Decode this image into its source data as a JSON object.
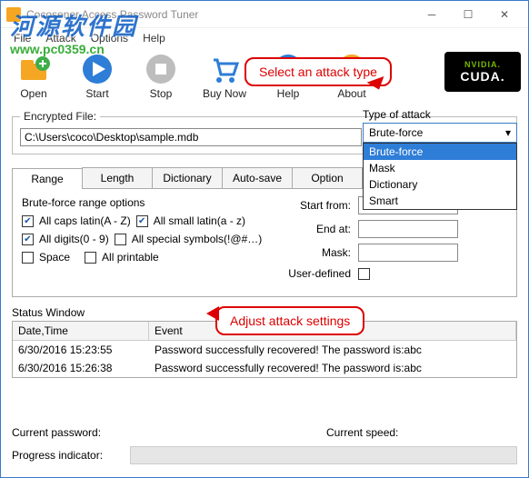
{
  "window": {
    "title": "Cocosenor Access Password Tuner"
  },
  "menu": {
    "file": "File",
    "attack": "Attack",
    "options": "Options",
    "help": "Help"
  },
  "watermark": {
    "cn": "河源软件园",
    "url": "www.pc0359.cn"
  },
  "toolbar": {
    "open": "Open",
    "start": "Start",
    "stop": "Stop",
    "buy": "Buy Now",
    "help": "Help",
    "about": "About"
  },
  "cuda": {
    "brand": "NVIDIA.",
    "name": "CUDA."
  },
  "callouts": {
    "attack": "Select an attack type",
    "adjust": "Adjust attack settings"
  },
  "file": {
    "label": "Encrypted File:",
    "path": "C:\\Users\\coco\\Desktop\\sample.mdb"
  },
  "attack": {
    "label": "Type of attack",
    "selected": "Brute-force",
    "options": [
      "Brute-force",
      "Mask",
      "Dictionary",
      "Smart"
    ]
  },
  "tabs": [
    "Range",
    "Length",
    "Dictionary",
    "Auto-save",
    "Option"
  ],
  "range": {
    "group": "Brute-force range options",
    "caps": "All caps latin(A - Z)",
    "small": "All small latin(a - z)",
    "digits": "All digits(0 - 9)",
    "symbols": "All special symbols(!@#…)",
    "space": "Space",
    "printable": "All printable",
    "startfrom": "Start from:",
    "endat": "End at:",
    "mask": "Mask:",
    "userdef": "User-defined"
  },
  "status": {
    "title": "Status Window",
    "cols": {
      "dt": "Date,Time",
      "ev": "Event"
    },
    "rows": [
      {
        "dt": "6/30/2016 15:23:55",
        "ev": "Password successfully recovered! The password is:abc"
      },
      {
        "dt": "6/30/2016 15:26:38",
        "ev": "Password successfully recovered! The password is:abc"
      }
    ]
  },
  "footer": {
    "curpass": "Current password:",
    "curspeed": "Current speed:",
    "progress": "Progress indicator:"
  }
}
